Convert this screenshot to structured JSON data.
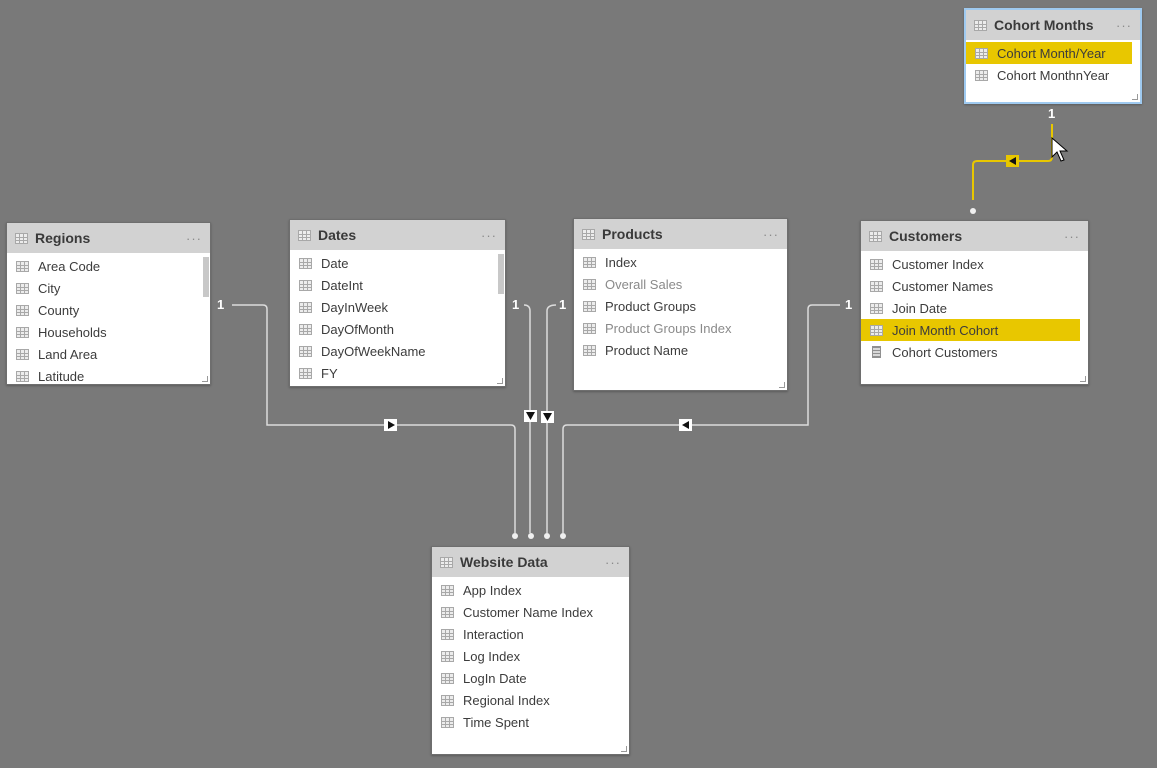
{
  "tables": {
    "cohort_months": {
      "title": "Cohort Months",
      "more": "···",
      "fields": [
        {
          "label": "Cohort Month/Year",
          "icon": "column-icon",
          "highlighted": true
        },
        {
          "label": "Cohort MonthnYear",
          "icon": "column-icon"
        }
      ]
    },
    "regions": {
      "title": "Regions",
      "more": "···",
      "fields": [
        {
          "label": "Area Code",
          "icon": "column-icon"
        },
        {
          "label": "City",
          "icon": "column-icon"
        },
        {
          "label": "County",
          "icon": "column-icon"
        },
        {
          "label": "Households",
          "icon": "column-icon"
        },
        {
          "label": "Land Area",
          "icon": "column-icon"
        },
        {
          "label": "Latitude",
          "icon": "column-icon"
        }
      ]
    },
    "dates": {
      "title": "Dates",
      "more": "···",
      "fields": [
        {
          "label": "Date",
          "icon": "column-icon"
        },
        {
          "label": "DateInt",
          "icon": "column-icon"
        },
        {
          "label": "DayInWeek",
          "icon": "column-icon"
        },
        {
          "label": "DayOfMonth",
          "icon": "column-icon"
        },
        {
          "label": "DayOfWeekName",
          "icon": "column-icon"
        },
        {
          "label": "FY",
          "icon": "column-icon"
        }
      ]
    },
    "products": {
      "title": "Products",
      "more": "···",
      "fields": [
        {
          "label": "Index",
          "icon": "column-icon"
        },
        {
          "label": "Overall Sales",
          "icon": "column-icon",
          "dimmed": true
        },
        {
          "label": "Product Groups",
          "icon": "column-icon"
        },
        {
          "label": "Product Groups Index",
          "icon": "column-icon",
          "dimmed": true
        },
        {
          "label": "Product Name",
          "icon": "column-icon"
        }
      ]
    },
    "customers": {
      "title": "Customers",
      "more": "···",
      "fields": [
        {
          "label": "Customer Index",
          "icon": "column-icon"
        },
        {
          "label": "Customer Names",
          "icon": "column-icon"
        },
        {
          "label": "Join Date",
          "icon": "column-icon"
        },
        {
          "label": "Join Month Cohort",
          "icon": "column-icon",
          "highlighted": true
        },
        {
          "label": "Cohort Customers",
          "icon": "measure-icon"
        }
      ]
    },
    "website_data": {
      "title": "Website Data",
      "more": "···",
      "fields": [
        {
          "label": "App Index",
          "icon": "column-icon"
        },
        {
          "label": "Customer Name Index",
          "icon": "column-icon"
        },
        {
          "label": "Interaction",
          "icon": "column-icon"
        },
        {
          "label": "Log Index",
          "icon": "column-icon"
        },
        {
          "label": "LogIn Date",
          "icon": "column-icon"
        },
        {
          "label": "Regional Index",
          "icon": "column-icon"
        },
        {
          "label": "Time Spent",
          "icon": "column-icon"
        }
      ]
    }
  },
  "relationships": [
    {
      "from": "regions",
      "to": "website_data",
      "one_label": "1",
      "many_label": "*",
      "direction": "right",
      "highlighted": false
    },
    {
      "from": "dates",
      "to": "website_data",
      "one_label": "1",
      "many_label": "*",
      "direction": "down",
      "highlighted": false
    },
    {
      "from": "products",
      "to": "website_data",
      "one_label": "1",
      "many_label": "*",
      "direction": "down",
      "highlighted": false
    },
    {
      "from": "customers",
      "to": "website_data",
      "one_label": "1",
      "many_label": "*",
      "direction": "left",
      "highlighted": false
    },
    {
      "from": "cohort_months",
      "to": "customers",
      "one_label": "1",
      "many_label": "*",
      "direction": "left",
      "highlighted": true
    }
  ],
  "colors": {
    "canvas": "#797979",
    "highlight": "#e8c700",
    "selected_border": "#9fcaf0",
    "line": "#e0e0e0"
  }
}
